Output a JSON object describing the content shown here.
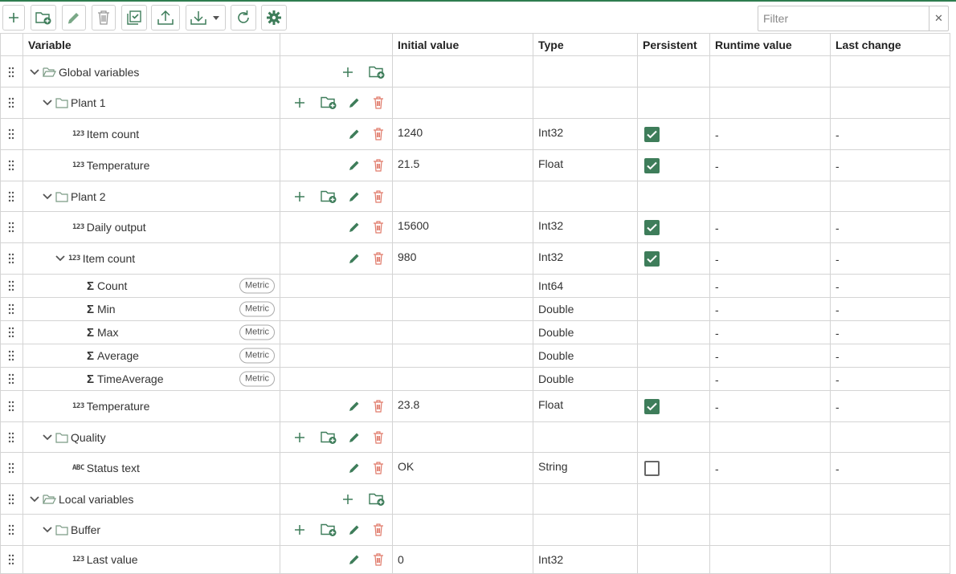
{
  "toolbar": {
    "filter_placeholder": "Filter",
    "filter_clear": "✕",
    "buttons": [
      "add-icon",
      "add-folder-icon",
      "edit-icon",
      "delete-icon",
      "select-all-icon",
      "upload-icon",
      "download-icon",
      "refresh-icon",
      "settings-icon"
    ]
  },
  "columns": {
    "variable": "Variable",
    "initial_value": "Initial value",
    "type": "Type",
    "persistent": "Persistent",
    "runtime_value": "Runtime value",
    "last_change": "Last change"
  },
  "rows": [
    {
      "name": "Global variables",
      "kind": "folder",
      "open": true,
      "level": 0
    },
    {
      "name": "Plant 1",
      "kind": "folder",
      "level": 1
    },
    {
      "name": "Item count",
      "kind": "var",
      "icon": "123",
      "level": 2,
      "initial": "1240",
      "type": "Int32",
      "persistent": true,
      "runtime": "-",
      "last": "-"
    },
    {
      "name": "Temperature",
      "kind": "var",
      "icon": "123",
      "level": 2,
      "initial": "21.5",
      "type": "Float",
      "persistent": true,
      "runtime": "-",
      "last": "-"
    },
    {
      "name": "Plant 2",
      "kind": "folder",
      "level": 1
    },
    {
      "name": "Daily output",
      "kind": "var",
      "icon": "123",
      "level": 2,
      "initial": "15600",
      "type": "Int32",
      "persistent": true,
      "runtime": "-",
      "last": "-"
    },
    {
      "name": "Item count",
      "kind": "var",
      "icon": "123",
      "level": 2,
      "expandable": true,
      "initial": "980",
      "type": "Int32",
      "persistent": true,
      "runtime": "-",
      "last": "-"
    },
    {
      "name": "Count",
      "kind": "metric",
      "level": 3,
      "badge": "Metric",
      "type": "Int64",
      "runtime": "-",
      "last": "-"
    },
    {
      "name": "Min",
      "kind": "metric",
      "level": 3,
      "badge": "Metric",
      "type": "Double",
      "runtime": "-",
      "last": "-"
    },
    {
      "name": "Max",
      "kind": "metric",
      "level": 3,
      "badge": "Metric",
      "type": "Double",
      "runtime": "-",
      "last": "-"
    },
    {
      "name": "Average",
      "kind": "metric",
      "level": 3,
      "badge": "Metric",
      "type": "Double",
      "runtime": "-",
      "last": "-"
    },
    {
      "name": "TimeAverage",
      "kind": "metric",
      "level": 3,
      "badge": "Metric",
      "type": "Double",
      "runtime": "-",
      "last": "-"
    },
    {
      "name": "Temperature",
      "kind": "var",
      "icon": "123",
      "level": 2,
      "initial": "23.8",
      "type": "Float",
      "persistent": true,
      "runtime": "-",
      "last": "-"
    },
    {
      "name": "Quality",
      "kind": "folder",
      "level": 1
    },
    {
      "name": "Status text",
      "kind": "var",
      "icon": "ABC",
      "level": 2,
      "initial": "OK",
      "type": "String",
      "persistent": false,
      "runtime": "-",
      "last": "-"
    },
    {
      "name": "Local variables",
      "kind": "folder",
      "open": true,
      "level": 0
    },
    {
      "name": "Buffer",
      "kind": "folder",
      "level": 1
    },
    {
      "name": "Last value",
      "kind": "var",
      "icon": "123",
      "level": 2,
      "initial": "0",
      "type": "Int32",
      "runtime": "",
      "last": ""
    }
  ],
  "colors": {
    "accent": "#3e7d5a",
    "delete": "#e07a6a",
    "border": "#d4d4d4"
  }
}
